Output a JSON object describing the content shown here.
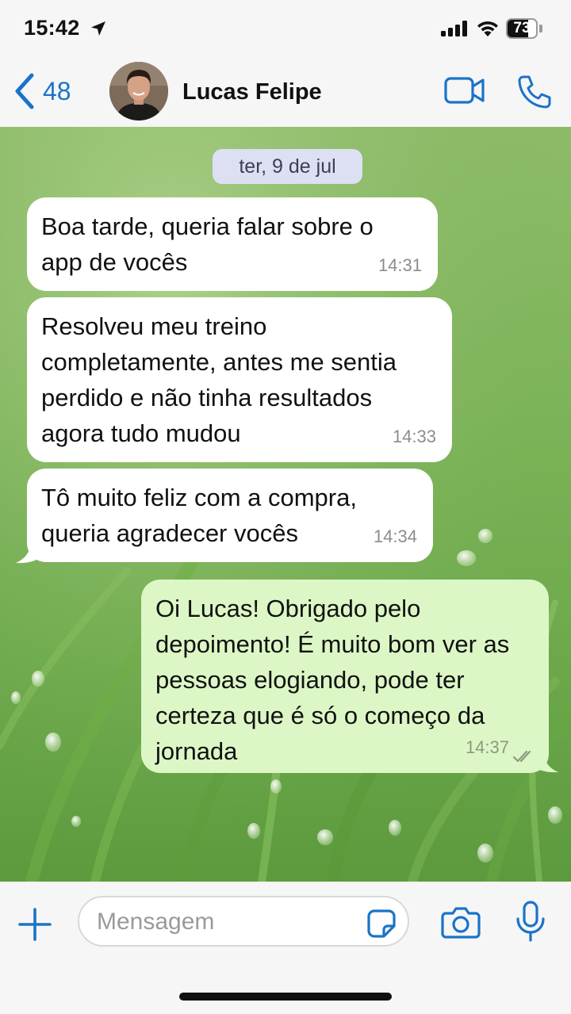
{
  "status_bar": {
    "time": "15:42",
    "battery": "73",
    "battery_level": 0.73
  },
  "header": {
    "back_count": "48",
    "contact_name": "Lucas Felipe"
  },
  "chat": {
    "date_chip": "ter, 9 de jul",
    "messages": [
      {
        "direction": "incoming",
        "text": "Boa tarde, queria falar sobre o\napp de vocês",
        "time": "14:31"
      },
      {
        "direction": "incoming",
        "text": "Resolveu meu treino\ncompletamente, antes me sentia\nperdido e não tinha resultados\nagora tudo mudou",
        "time": "14:33"
      },
      {
        "direction": "incoming",
        "text": "Tô muito feliz com a compra,\nqueria agradecer vocês",
        "time": "14:34"
      },
      {
        "direction": "outgoing",
        "text": "Oi Lucas! Obrigado pelo\ndepoimento! É muito bom ver as\npessoas elogiando, pode ter\ncerteza que é só o começo da\njornada",
        "time": "14:37",
        "status": "read"
      }
    ]
  },
  "input_bar": {
    "placeholder": "Mensagem"
  },
  "colors": {
    "accent": "#1a73c9",
    "incoming_bubble": "#ffffff",
    "outgoing_bubble": "#dcf7c5",
    "date_chip": "#dde0f3"
  }
}
